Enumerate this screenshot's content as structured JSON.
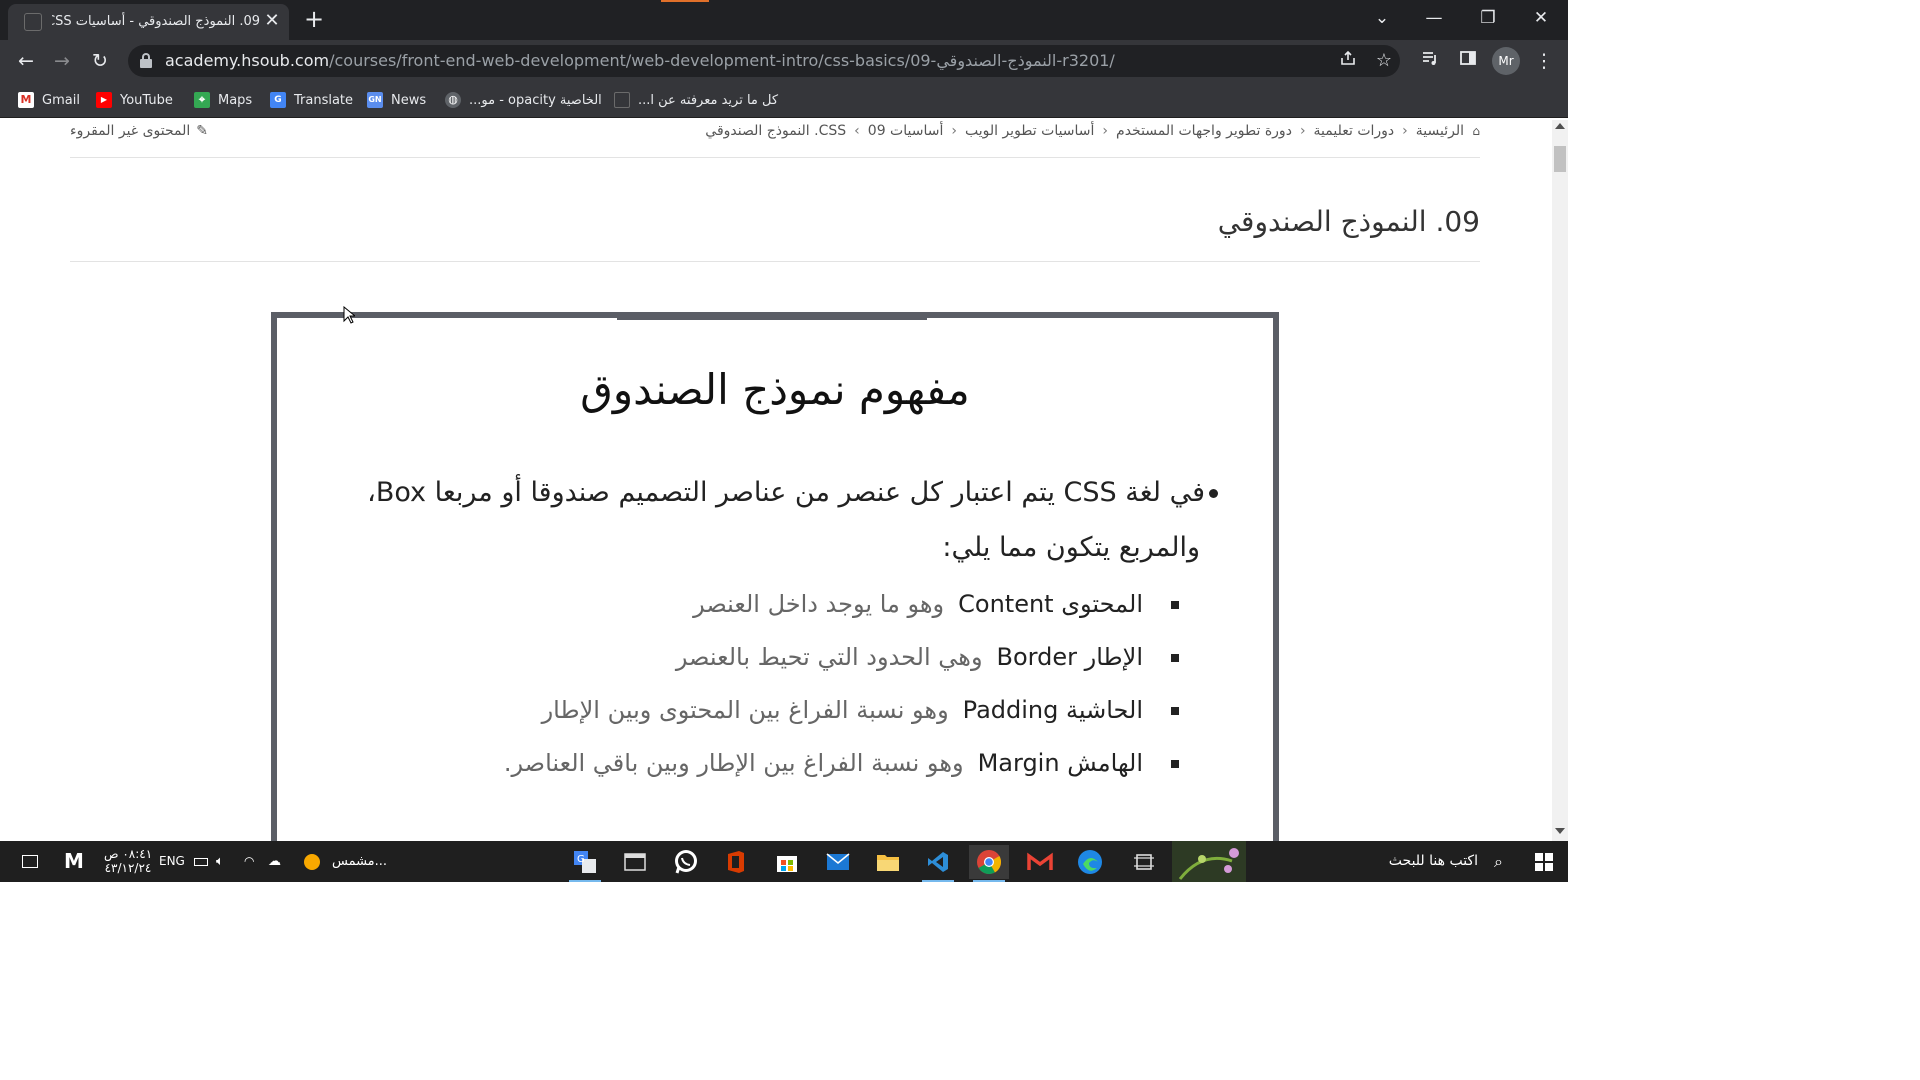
{
  "browser": {
    "tab": {
      "title": "09. النموذج الصندوقي - أساسيات CSS",
      "close_glyph": "✕"
    },
    "new_tab_glyph": "+",
    "window_controls": {
      "tab_search": "⌄",
      "minimize": "—",
      "restore": "❐",
      "close": "✕"
    },
    "nav": {
      "back": "←",
      "forward": "→",
      "reload": "↻"
    },
    "url": {
      "host": "academy.hsoub.com",
      "path": "/courses/front-end-web-development/web-development-intro/css-basics/09-النموذج-الصندوقي-r3201/"
    },
    "profile_initials": "Mr",
    "menu_glyph": "⋮",
    "bookmarks": [
      {
        "label": "Gmail",
        "icon": "gmail-icon"
      },
      {
        "label": "YouTube",
        "icon": "youtube-icon"
      },
      {
        "label": "Maps",
        "icon": "maps-icon"
      },
      {
        "label": "Translate",
        "icon": "translate-icon"
      },
      {
        "label": "News",
        "icon": "news-icon"
      },
      {
        "label": "الخاصية opacity - مو...",
        "icon": "globe-icon"
      },
      {
        "label": "كل ما تريد معرفته عن ا...",
        "icon": "page-icon"
      }
    ]
  },
  "page": {
    "breadcrumb": {
      "items": [
        "الرئيسية",
        "دورات تعليمية",
        "دورة تطوير واجهات المستخدم",
        "أساسيات تطوير الويب",
        "أساسيات CSS",
        "09. النموذج الصندوقي"
      ]
    },
    "unread_label": "المحتوى غير المقروء",
    "lesson_title": "09. النموذج الصندوقي",
    "slide": {
      "title": "مفهوم نموذج الصندوق",
      "bullet_line1": "في لغة CSS  يتم اعتبار كل عنصر من عناصر التصميم صندوقا أو مربعا Box،",
      "bullet_line2": "والمربع يتكون مما يلي:",
      "items": [
        {
          "term": "المحتوى Content",
          "desc": "وهو ما يوجد داخل العنصر"
        },
        {
          "term": "الإطار Border",
          "desc": "وهي الحدود التي تحيط بالعنصر"
        },
        {
          "term": "الحاشية Padding",
          "desc": "وهو نسبة الفراغ بين المحتوى وبين الإطار"
        },
        {
          "term": "الهامش Margin",
          "desc": "وهو نسبة الفراغ بين الإطار وبين باقي العناصر."
        }
      ]
    }
  },
  "taskbar": {
    "search_placeholder": "اكتب هنا للبحث",
    "weather_label": "مشمس...",
    "language": "ENG",
    "time": "٠٨:٤١ ص",
    "date": "٤٣/١٢/٢٤",
    "pinned_apps": [
      "translate-app-icon",
      "terminal-icon",
      "whatsapp-icon",
      "office-icon",
      "store-icon",
      "mail-icon",
      "file-explorer-icon",
      "vscode-icon",
      "chrome-icon",
      "gmail-app-icon",
      "edge-icon",
      "snipping-tool-icon"
    ]
  },
  "colors": {
    "browser_dark": "#202124",
    "browser_toolbar": "#35363a",
    "slide_border": "#5b5e66",
    "taskbar": "#1f1f1f",
    "taskbar_active": "#76b9ed"
  }
}
